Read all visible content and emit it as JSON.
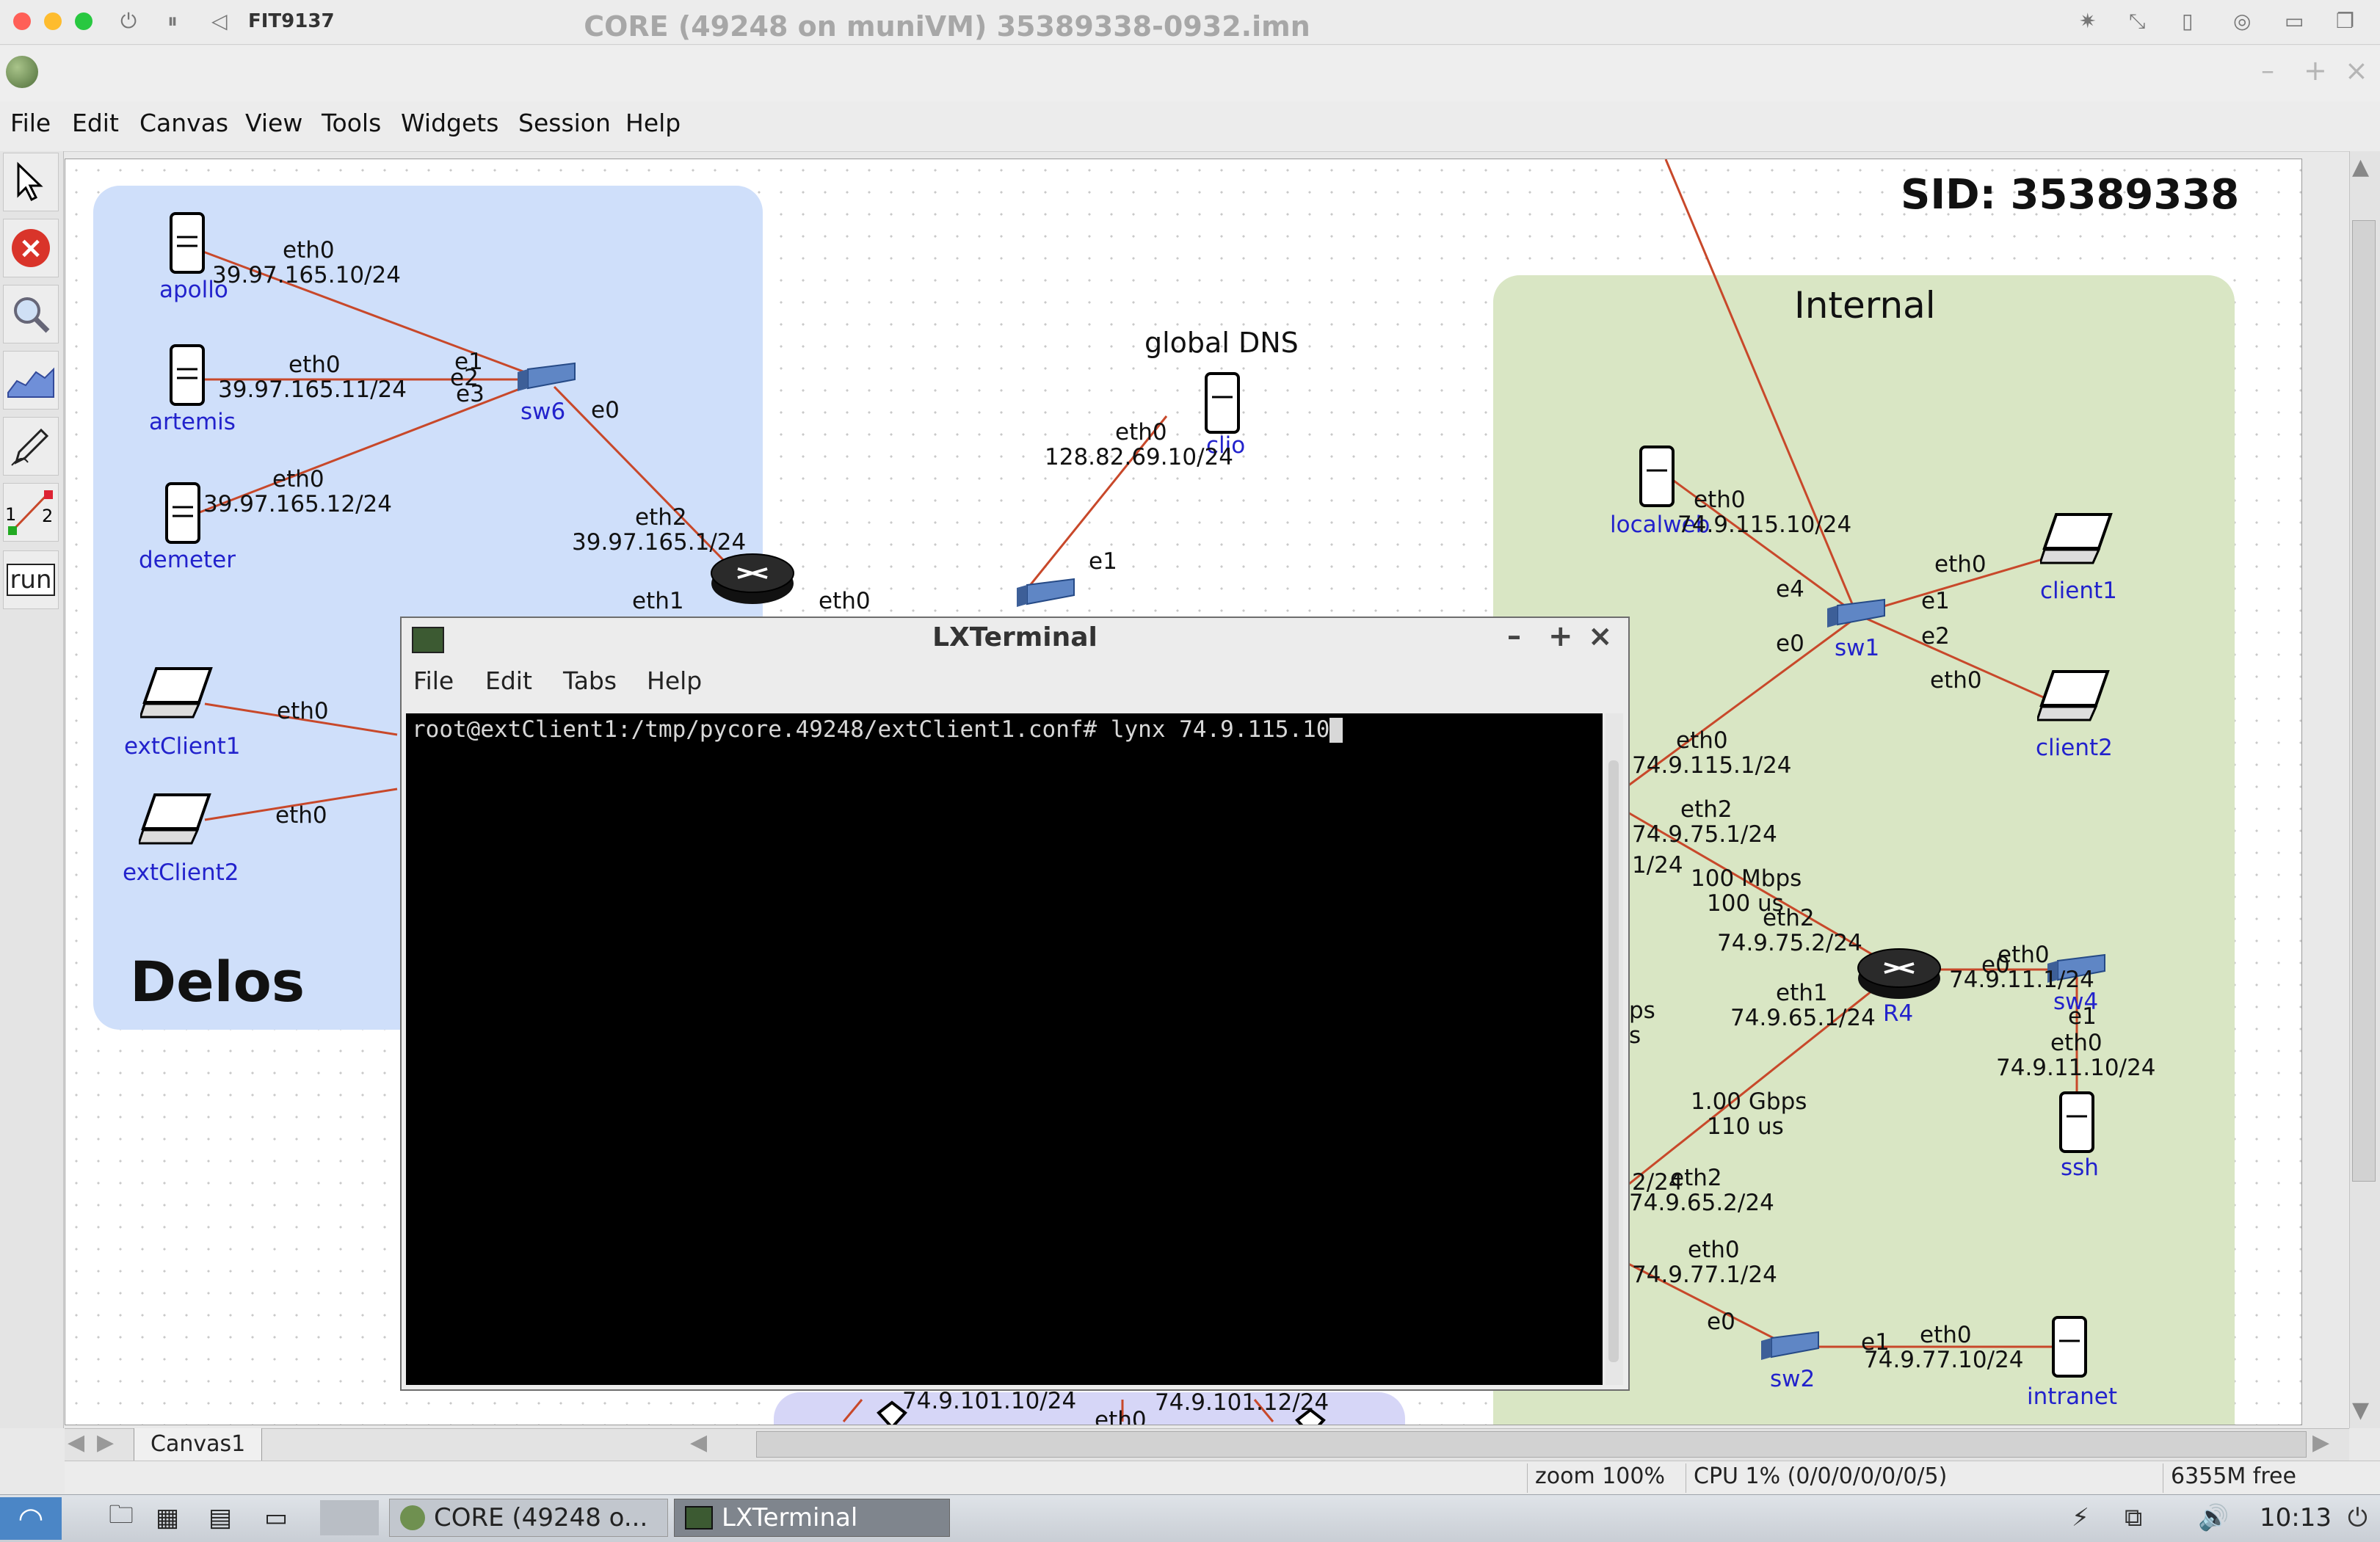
{
  "host": {
    "title": "FIT9137"
  },
  "window": {
    "title": "CORE (49248 on muniVM) 35389338-0932.imn"
  },
  "menu": [
    "File",
    "Edit",
    "Canvas",
    "View",
    "Tools",
    "Widgets",
    "Session",
    "Help"
  ],
  "toolbar": {
    "run_label": "run",
    "link_labels": [
      "1",
      "2"
    ]
  },
  "canvas": {
    "sid": "SID: 35389338",
    "zones": {
      "delos": "Delos",
      "internal": "Internal"
    },
    "nodes": {
      "apollo": "apollo",
      "artemis": "artemis",
      "demeter": "demeter",
      "sw6": "sw6",
      "extClient1": "extClient1",
      "extClient2": "extClient2",
      "global_dns": "global DNS",
      "clio": "clio",
      "localweb": "localweb",
      "sw1": "sw1",
      "client1": "client1",
      "client2": "client2",
      "r4": "R4",
      "sw4": "sw4",
      "ssh": "ssh",
      "sw2": "sw2",
      "intranet": "intranet"
    },
    "iface": {
      "apollo_eth0": "eth0",
      "apollo_ip": "39.97.165.10/24",
      "artemis_eth0": "eth0",
      "artemis_ip": "39.97.165.11/24",
      "demeter_eth0": "eth0",
      "demeter_ip": "39.97.165.12/24",
      "sw6_e1": "e1",
      "sw6_e2": "e2",
      "sw6_e3": "e3",
      "sw6_e0": "e0",
      "r_eth2": "eth2",
      "r_eth2_ip": "39.97.165.1/24",
      "r_eth1": "eth1",
      "r_eth0": "eth0",
      "ext1_eth0": "eth0",
      "ext2_eth0": "eth0",
      "clio_eth0": "eth0",
      "clio_ip": "128.82.69.10/24",
      "dns_sw_e1": "e1",
      "lw_eth0": "eth0",
      "lw_ip": "74.9.115.10/24",
      "sw1_e4": "e4",
      "sw1_e0": "e0",
      "sw1_e1": "e1",
      "sw1_e2": "e2",
      "c1_eth0": "eth0",
      "c2_eth0": "eth0",
      "rA_eth0": "eth0",
      "rA_ip": "74.9.115.1/24",
      "rA_eth2": "eth2",
      "rA_eth2_ip": "74.9.75.1/24",
      "rA_frag": "1/24",
      "link1_bw": "100 Mbps",
      "link1_delay": "100 us",
      "r4_eth2": "eth2",
      "r4_eth2_ip": "74.9.75.2/24",
      "r4_eth0": "eth0",
      "r4_eth0_ip": "74.9.11.1/24",
      "sw4_e0": "e0",
      "sw4_e1": "e1",
      "ssh_eth0": "eth0",
      "ssh_ip": "74.9.11.10/24",
      "r4_eth1": "eth1",
      "r4_eth1_ip": "74.9.65.1/24",
      "frag_ps": "ps",
      "frag_s": "s",
      "link2_bw": "1.00 Gbps",
      "link2_delay": "110 us",
      "rB_eth2": "eth2",
      "rB_eth2_ip": "74.9.65.2/24",
      "rB_frag": "2/24",
      "rB_eth0": "eth0",
      "rB_eth0_ip": "74.9.77.1/24",
      "sw2_e0": "e0",
      "sw2_e1": "e1",
      "intranet_eth0": "eth0",
      "intranet_ip": "74.9.77.10/24",
      "bottom_ip1": "74.9.101.10/24",
      "bottom_ip2": "74.9.101.12/24",
      "bottom_eth0": "eth0"
    }
  },
  "canvas_tab": "Canvas1",
  "status": {
    "zoom": "zoom 100%",
    "cpu": "CPU 1% (0/0/0/0/0/0/5)",
    "mem": "6355M free"
  },
  "taskbar": {
    "core_item": "CORE (49248 o...",
    "lx_item": "LXTerminal",
    "clock": "10:13"
  },
  "terminal": {
    "title": "LXTerminal",
    "menu": [
      "File",
      "Edit",
      "Tabs",
      "Help"
    ],
    "command": "root@extClient1:/tmp/pycore.49248/extClient1.conf# lynx 74.9.115.10"
  },
  "colors": {
    "link": "#c8482a",
    "delos_zone": "#cfdffa",
    "internal_zone": "#d9e6c4",
    "node_label": "#2222cc"
  }
}
